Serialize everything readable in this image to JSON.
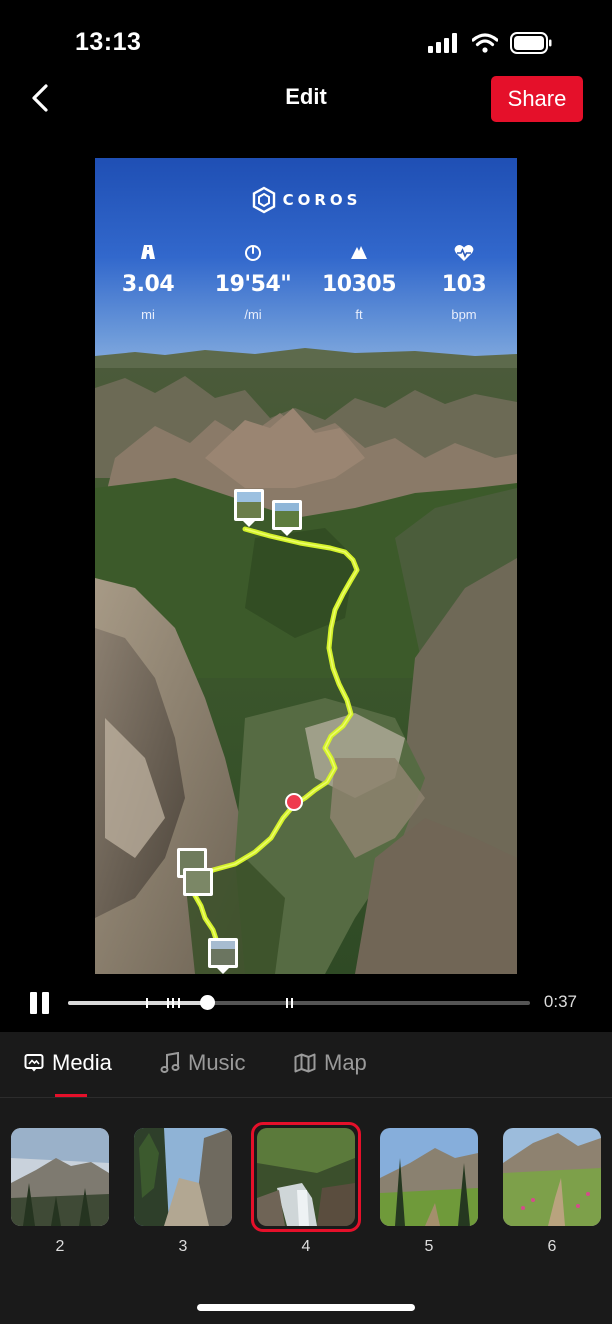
{
  "status_bar": {
    "time": "13:13"
  },
  "header": {
    "title": "Edit",
    "share_label": "Share"
  },
  "preview": {
    "brand": "COROS",
    "stats": [
      {
        "value": "3.04",
        "unit": "mi",
        "icon": "road-icon"
      },
      {
        "value": "19'54\"",
        "unit": "/mi",
        "icon": "speedometer-icon"
      },
      {
        "value": "10305",
        "unit": "ft",
        "icon": "mountain-icon"
      },
      {
        "value": "103",
        "unit": "bpm",
        "icon": "heart-rate-icon"
      }
    ]
  },
  "playback": {
    "elapsed_label": "0:37",
    "progress_fraction": 0.3
  },
  "tabs": [
    {
      "label": "Media",
      "icon": "media-icon",
      "active": true
    },
    {
      "label": "Music",
      "icon": "music-note-icon",
      "active": false
    },
    {
      "label": "Map",
      "icon": "map-icon",
      "active": false
    }
  ],
  "thumbnails": [
    {
      "number": "2",
      "selected": false
    },
    {
      "number": "3",
      "selected": false
    },
    {
      "number": "4",
      "selected": true
    },
    {
      "number": "5",
      "selected": false
    },
    {
      "number": "6",
      "selected": false
    }
  ],
  "colors": {
    "accent": "#e5102a",
    "route": "#d4f22a",
    "background": "#000000",
    "panel": "#1a1a1a"
  }
}
